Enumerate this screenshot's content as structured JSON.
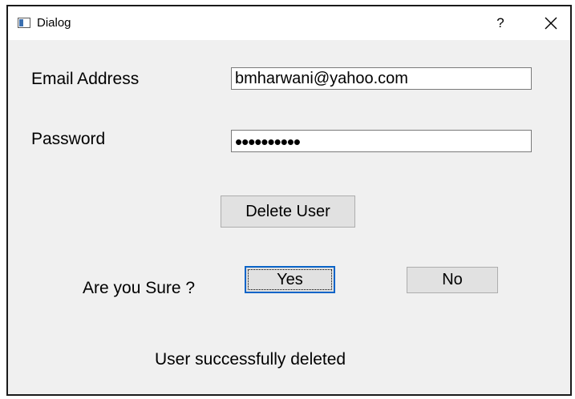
{
  "window": {
    "title": "Dialog",
    "help_label": "?",
    "app_icon": "window-icon",
    "close_icon": "close-icon"
  },
  "form": {
    "email_label": "Email Address",
    "email_value": "bmharwani@yahoo.com",
    "password_label": "Password",
    "password_value": "••••••••••"
  },
  "actions": {
    "delete_label": "Delete User",
    "confirm_prompt": "Are you Sure ?",
    "yes_label": "Yes",
    "no_label": "No"
  },
  "status": {
    "message": "User successfully deleted"
  },
  "colors": {
    "window_bg": "#f0f0f0",
    "titlebar_bg": "#ffffff",
    "button_bg": "#e1e1e1",
    "focus_border": "#0a64c8"
  }
}
